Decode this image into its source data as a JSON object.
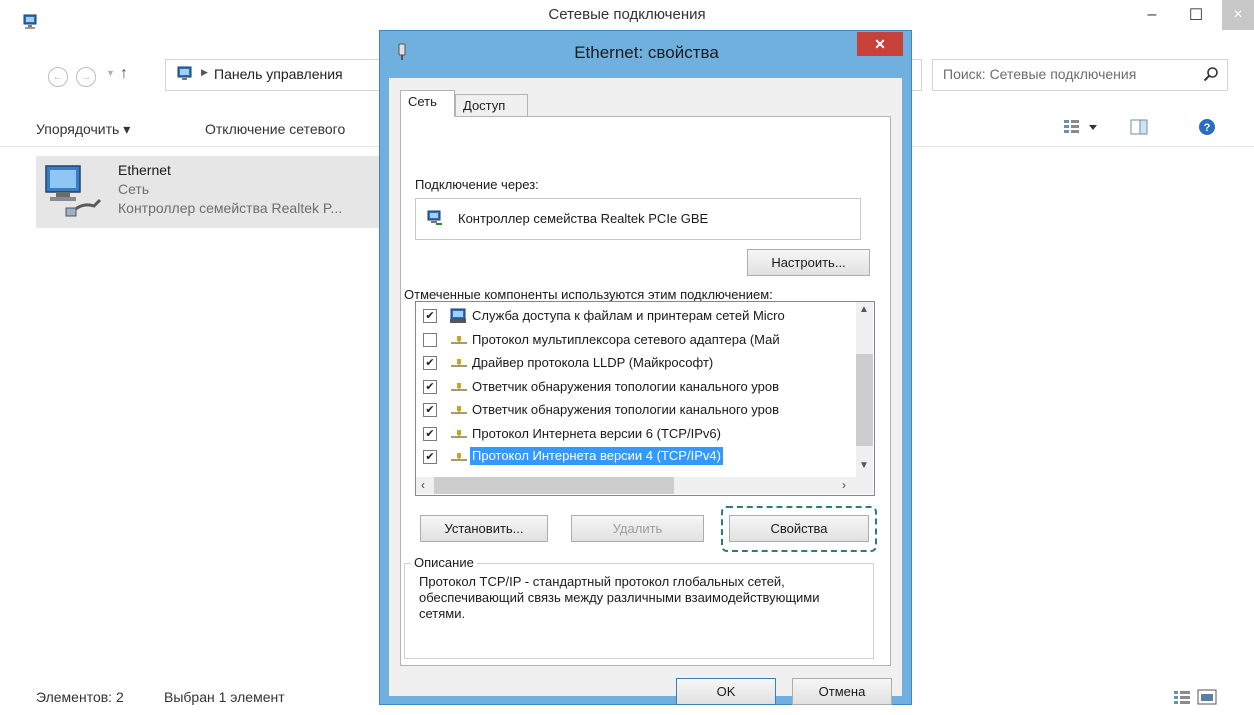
{
  "explorer": {
    "title": "Сетевые подключения",
    "window_controls": {
      "minimize": "–",
      "maximize": "☐",
      "close": "×"
    },
    "address_path": "Панель управления",
    "search_placeholder": "Поиск: Сетевые подключения",
    "toolbar": {
      "organize_label": "Упорядочить ▾",
      "disable_label": "Отключение сетевого"
    },
    "connection": {
      "name": "Ethernet",
      "network": "Сеть",
      "adapter": "Контроллер семейства Realtek P..."
    },
    "status": {
      "items_count": "Элементов: 2",
      "selected": "Выбран 1 элемент"
    }
  },
  "dialog": {
    "title": "Ethernet: свойства",
    "close_glyph": "✕",
    "tabs": [
      {
        "label": "Сеть",
        "active": true
      },
      {
        "label": "Доступ",
        "active": false
      }
    ],
    "connect_using_label": "Подключение через:",
    "adapter_name": "Контроллер семейства Realtek PCIe GBE",
    "configure_button": "Настроить...",
    "components_label": "Отмеченные компоненты используются этим подключением:",
    "components": [
      {
        "checked": true,
        "label": "Служба доступа к файлам и принтерам сетей Micro",
        "icon": "service-icon"
      },
      {
        "checked": false,
        "label": "Протокол мультиплексора сетевого адаптера (Май",
        "icon": "protocol-icon"
      },
      {
        "checked": true,
        "label": "Драйвер протокола LLDP (Майкрософт)",
        "icon": "protocol-icon"
      },
      {
        "checked": true,
        "label": "Ответчик обнаружения топологии канального уров",
        "icon": "protocol-icon"
      },
      {
        "checked": true,
        "label": "Ответчик обнаружения топологии канального уров",
        "icon": "protocol-icon"
      },
      {
        "checked": true,
        "label": "Протокол Интернета версии 6 (TCP/IPv6)",
        "icon": "protocol-icon"
      },
      {
        "checked": true,
        "label": "Протокол Интернета версии 4 (TCP/IPv4)",
        "icon": "protocol-icon",
        "selected": true
      }
    ],
    "install_button": "Установить...",
    "uninstall_button": "Удалить",
    "properties_button": "Свойства",
    "description_title": "Описание",
    "description_text": "Протокол TCP/IP - стандартный протокол глобальных сетей, обеспечивающий связь между различными взаимодействующими сетями.",
    "ok_button": "OK",
    "cancel_button": "Отмена"
  },
  "colors": {
    "dialog_frame": "#6fb0df",
    "close_red": "#c7413a",
    "selection_blue": "#3399ff",
    "focus_frame": "#2e7d74"
  }
}
